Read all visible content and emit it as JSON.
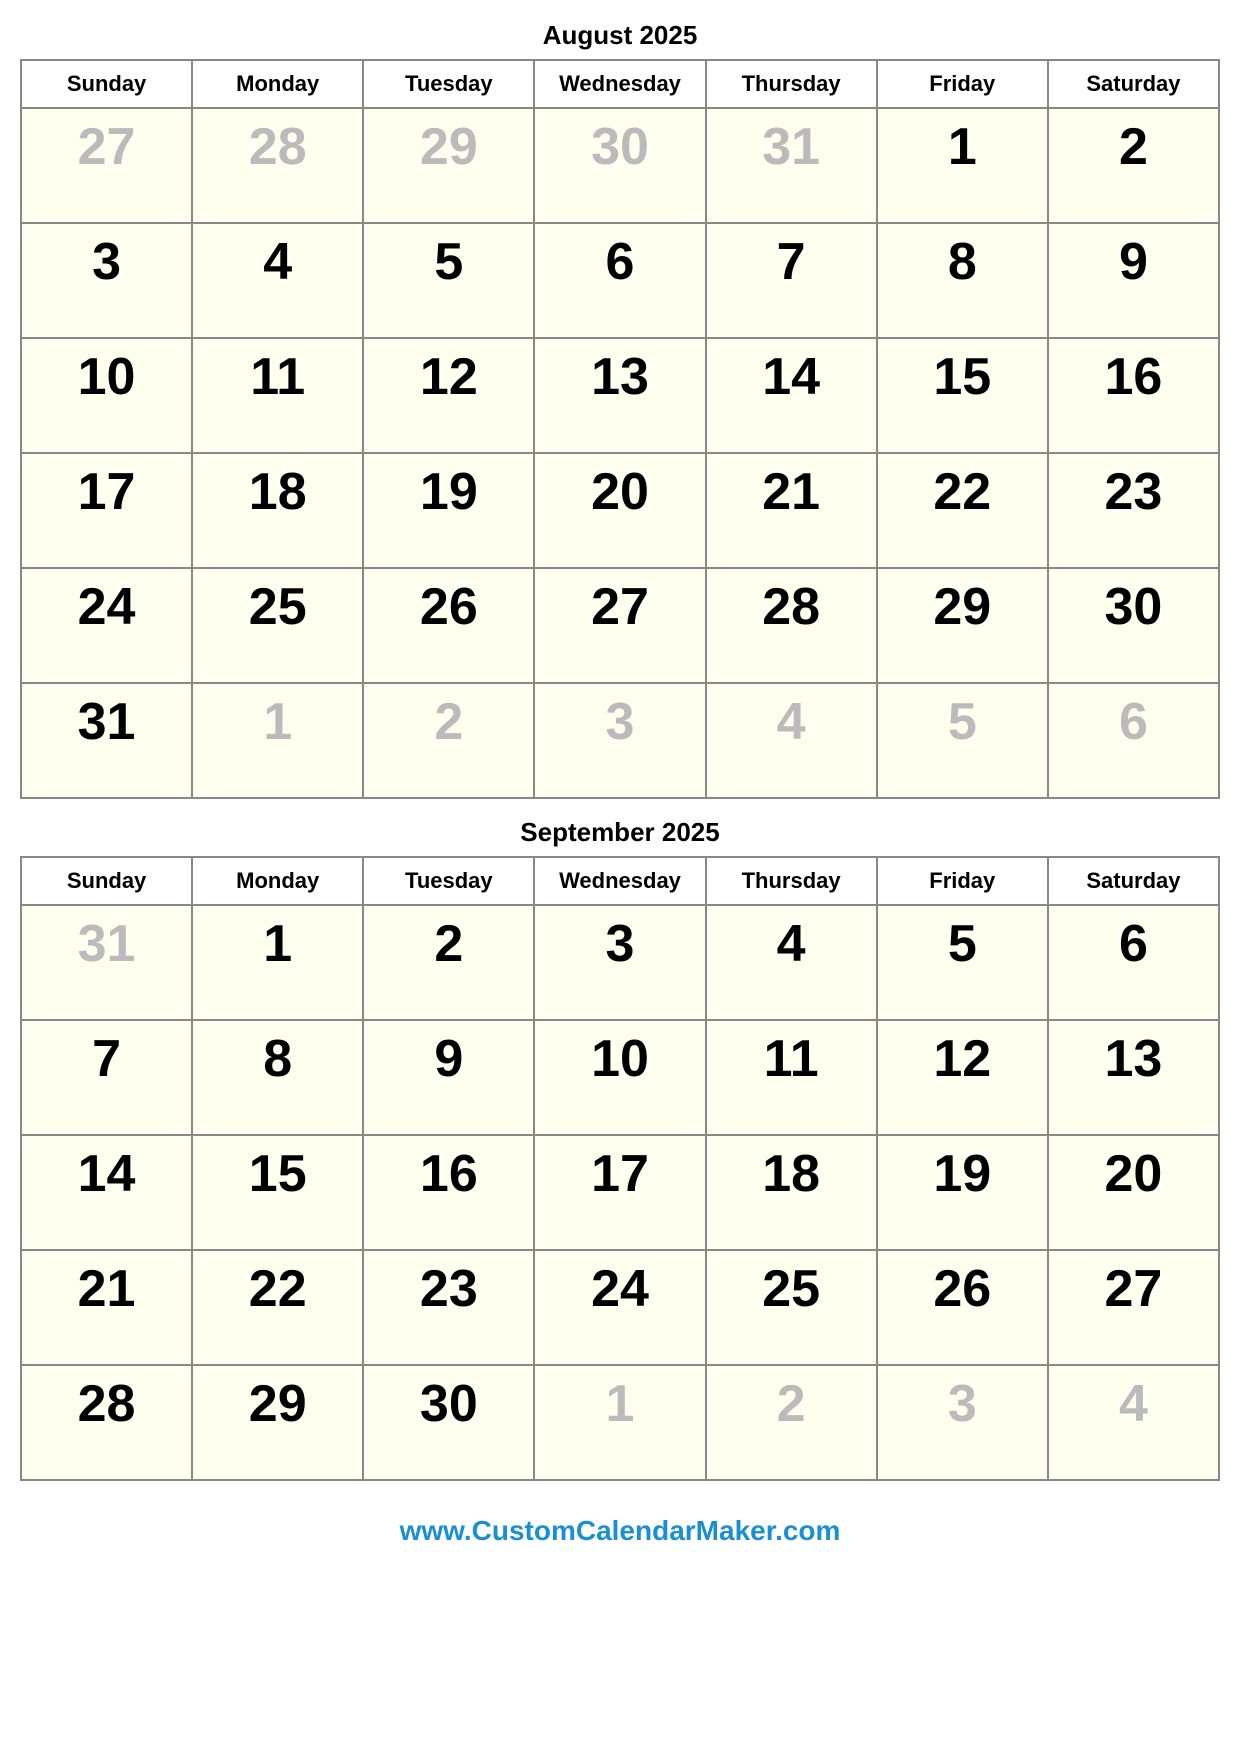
{
  "august": {
    "title": "August 2025",
    "headers": [
      "Sunday",
      "Monday",
      "Tuesday",
      "Wednesday",
      "Thursday",
      "Friday",
      "Saturday"
    ],
    "weeks": [
      [
        {
          "day": "27",
          "type": "other-month"
        },
        {
          "day": "28",
          "type": "other-month"
        },
        {
          "day": "29",
          "type": "other-month"
        },
        {
          "day": "30",
          "type": "other-month"
        },
        {
          "day": "31",
          "type": "other-month"
        },
        {
          "day": "1",
          "type": "current-month"
        },
        {
          "day": "2",
          "type": "current-month"
        }
      ],
      [
        {
          "day": "3",
          "type": "current-month"
        },
        {
          "day": "4",
          "type": "current-month"
        },
        {
          "day": "5",
          "type": "current-month"
        },
        {
          "day": "6",
          "type": "current-month"
        },
        {
          "day": "7",
          "type": "current-month"
        },
        {
          "day": "8",
          "type": "current-month"
        },
        {
          "day": "9",
          "type": "current-month"
        }
      ],
      [
        {
          "day": "10",
          "type": "current-month"
        },
        {
          "day": "11",
          "type": "current-month"
        },
        {
          "day": "12",
          "type": "current-month"
        },
        {
          "day": "13",
          "type": "current-month"
        },
        {
          "day": "14",
          "type": "current-month"
        },
        {
          "day": "15",
          "type": "current-month"
        },
        {
          "day": "16",
          "type": "current-month"
        }
      ],
      [
        {
          "day": "17",
          "type": "current-month"
        },
        {
          "day": "18",
          "type": "current-month"
        },
        {
          "day": "19",
          "type": "current-month"
        },
        {
          "day": "20",
          "type": "current-month"
        },
        {
          "day": "21",
          "type": "current-month"
        },
        {
          "day": "22",
          "type": "current-month"
        },
        {
          "day": "23",
          "type": "current-month"
        }
      ],
      [
        {
          "day": "24",
          "type": "current-month"
        },
        {
          "day": "25",
          "type": "current-month"
        },
        {
          "day": "26",
          "type": "current-month"
        },
        {
          "day": "27",
          "type": "current-month"
        },
        {
          "day": "28",
          "type": "current-month"
        },
        {
          "day": "29",
          "type": "current-month"
        },
        {
          "day": "30",
          "type": "current-month"
        }
      ],
      [
        {
          "day": "31",
          "type": "current-month"
        },
        {
          "day": "1",
          "type": "other-month"
        },
        {
          "day": "2",
          "type": "other-month"
        },
        {
          "day": "3",
          "type": "other-month"
        },
        {
          "day": "4",
          "type": "other-month"
        },
        {
          "day": "5",
          "type": "other-month"
        },
        {
          "day": "6",
          "type": "other-month"
        }
      ]
    ]
  },
  "september": {
    "title": "September 2025",
    "headers": [
      "Sunday",
      "Monday",
      "Tuesday",
      "Wednesday",
      "Thursday",
      "Friday",
      "Saturday"
    ],
    "weeks": [
      [
        {
          "day": "31",
          "type": "other-month"
        },
        {
          "day": "1",
          "type": "current-month"
        },
        {
          "day": "2",
          "type": "current-month"
        },
        {
          "day": "3",
          "type": "current-month"
        },
        {
          "day": "4",
          "type": "current-month"
        },
        {
          "day": "5",
          "type": "current-month"
        },
        {
          "day": "6",
          "type": "current-month"
        }
      ],
      [
        {
          "day": "7",
          "type": "current-month"
        },
        {
          "day": "8",
          "type": "current-month"
        },
        {
          "day": "9",
          "type": "current-month"
        },
        {
          "day": "10",
          "type": "current-month"
        },
        {
          "day": "11",
          "type": "current-month"
        },
        {
          "day": "12",
          "type": "current-month"
        },
        {
          "day": "13",
          "type": "current-month"
        }
      ],
      [
        {
          "day": "14",
          "type": "current-month"
        },
        {
          "day": "15",
          "type": "current-month"
        },
        {
          "day": "16",
          "type": "current-month"
        },
        {
          "day": "17",
          "type": "current-month"
        },
        {
          "day": "18",
          "type": "current-month"
        },
        {
          "day": "19",
          "type": "current-month"
        },
        {
          "day": "20",
          "type": "current-month"
        }
      ],
      [
        {
          "day": "21",
          "type": "current-month"
        },
        {
          "day": "22",
          "type": "current-month"
        },
        {
          "day": "23",
          "type": "current-month"
        },
        {
          "day": "24",
          "type": "current-month"
        },
        {
          "day": "25",
          "type": "current-month"
        },
        {
          "day": "26",
          "type": "current-month"
        },
        {
          "day": "27",
          "type": "current-month"
        }
      ],
      [
        {
          "day": "28",
          "type": "current-month"
        },
        {
          "day": "29",
          "type": "current-month"
        },
        {
          "day": "30",
          "type": "current-month"
        },
        {
          "day": "1",
          "type": "other-month"
        },
        {
          "day": "2",
          "type": "other-month"
        },
        {
          "day": "3",
          "type": "other-month"
        },
        {
          "day": "4",
          "type": "other-month"
        }
      ]
    ]
  },
  "footer": {
    "link": "www.CustomCalendarMaker.com"
  }
}
